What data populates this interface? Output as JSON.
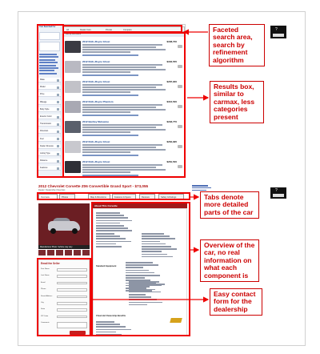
{
  "annotations": {
    "faceted_search": "Faceted search area, search by refinement algorithm",
    "results_box": "Results box, similar to carmax, less categories present",
    "tabs": "Tabs denote more detailed parts of the car",
    "overview": "Overview of the car, no real information on what each component is",
    "contact_form": "Easy contact form for the dealership"
  },
  "search_page": {
    "sidebar_title": "Your Searched For",
    "facet_items": [
      "Make",
      "Model",
      "Price",
      "Mileage",
      "Body Style",
      "Exterior Color",
      "Transmission",
      "Drivetrain",
      "Fuel",
      "Dealer Reviews",
      "Listing Type",
      "Distance",
      "Features"
    ],
    "filter_tabs": [
      "All",
      "Dealer Cars",
      "Private",
      "Compare"
    ],
    "sort_label": "Sort by: Best Match",
    "results": [
      {
        "title": "2012 Rolls-Royce Ghost",
        "price": "$308,700",
        "thumb_color": "#3a3a42"
      },
      {
        "title": "2012 Rolls-Royce Ghost",
        "price": "$302,555",
        "thumb_color": "#b9b9c2"
      },
      {
        "title": "2012 Rolls-Royce Ghost",
        "price": "$287,900",
        "thumb_color": "#c2c2c8"
      },
      {
        "title": "2012 Rolls-Royce Phantom",
        "price": "$316,500",
        "thumb_color": "#a9a9b3"
      },
      {
        "title": "2012 Bentley Mulsanne",
        "price": "$293,770",
        "thumb_color": "#5a5f6b"
      },
      {
        "title": "2012 Rolls-Royce Ghost",
        "price": "$284,995",
        "thumb_color": "#c8c8ce"
      },
      {
        "title": "2012 Rolls-Royce Ghost",
        "price": "$281,500",
        "thumb_color": "#2f2f36"
      }
    ]
  },
  "detail_page": {
    "title": "2012 Chevrolet Corvette Z06 Convertible Grand Sport - $73,055",
    "subtitle": "Dealer: Dealership Chevrolet",
    "tabs": [
      "Overview",
      "Photos",
      "Map & Directions",
      "Features & Specs",
      "Reviews",
      "Safety & Ratings"
    ],
    "about_heading": "About This Corvette",
    "photo_caption": "Manufacturer Photo: Vehicle may vary",
    "contact_heading": "Email the Seller",
    "contact_fields": [
      "First Name",
      "Last Name",
      "Email",
      "Phone",
      "Street Address",
      "City",
      "State",
      "ZIP Code",
      "Comments"
    ],
    "spec_headings": [
      "Features",
      "Standard Equipment",
      "Chevrolet Ownership Benefits"
    ]
  },
  "side_widget_label": "?"
}
